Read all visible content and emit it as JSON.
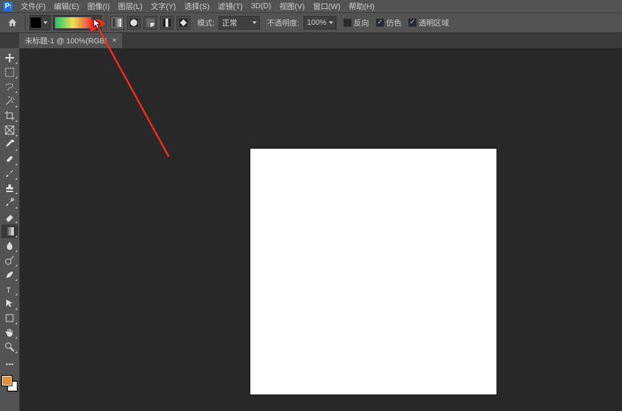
{
  "menu": [
    "文件(F)",
    "编辑(E)",
    "图像(I)",
    "图层(L)",
    "文字(Y)",
    "选择(S)",
    "滤镜(T)",
    "3D(D)",
    "视图(V)",
    "窗口(W)",
    "帮助(H)"
  ],
  "options": {
    "mode_label": "模式:",
    "mode_value": "正常",
    "opacity_label": "不透明度:",
    "opacity_value": "100%",
    "reverse": "反向",
    "dither": "仿色",
    "transparency": "透明区域"
  },
  "tab": {
    "title": "未标题-1 @ 100%(RGB/",
    "close": "×"
  },
  "tools": [
    "move",
    "marquee",
    "lasso",
    "wand",
    "crop",
    "frame",
    "eyedropper",
    "heal",
    "brush",
    "stamp",
    "history",
    "eraser",
    "gradient",
    "blur",
    "dodge",
    "pen",
    "type",
    "path-sel",
    "rect",
    "hand",
    "zoom"
  ],
  "colors": {
    "fg": "#e0903e",
    "bg": "#ffffff"
  }
}
